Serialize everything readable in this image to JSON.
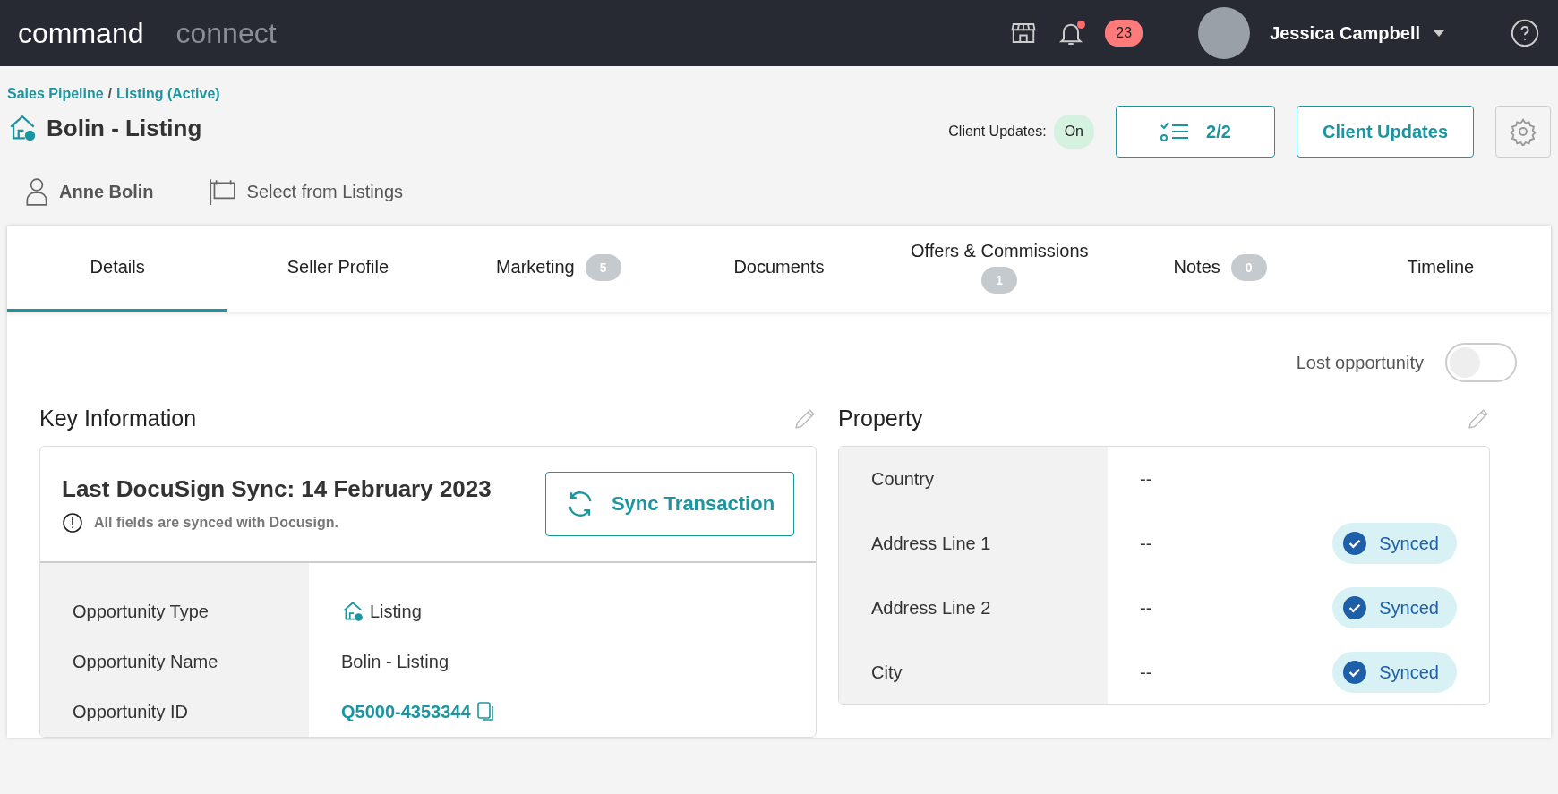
{
  "top_bar": {
    "brand_primary": "command",
    "brand_secondary": "connect",
    "notifications": {
      "unread": true,
      "count": "23"
    },
    "user": {
      "name": "Jessica Campbell"
    }
  },
  "header": {
    "breadcrumb": [
      {
        "label": "Sales Pipeline"
      },
      {
        "label": "Listing (Active)"
      }
    ],
    "breadcrumb_separator": "/",
    "title": "Bolin - Listing",
    "contact": "Anne Bolin",
    "listing_selector": "Select from Listings",
    "client_updates": {
      "label": "Client Updates:",
      "status": "On"
    },
    "tasks_button": "2/2",
    "client_updates_button": "Client Updates"
  },
  "tabs": [
    {
      "label": "Details",
      "selected": true
    },
    {
      "label": "Seller Profile",
      "selected": false
    },
    {
      "label": "Marketing",
      "count": "5",
      "selected": false
    },
    {
      "label": "Documents",
      "selected": false
    },
    {
      "label": "Offers & Commissions",
      "count": "1",
      "selected": false
    },
    {
      "label": "Notes",
      "count": "0",
      "selected": false
    },
    {
      "label": "Timeline",
      "selected": false
    }
  ],
  "lost_opportunity": {
    "label": "Lost opportunity",
    "on": false
  },
  "key_information": {
    "title": "Key Information",
    "sync_title": "Last DocuSign Sync: 14 February 2023",
    "sync_note": "All fields are synced with Docusign.",
    "sync_button": "Sync Transaction",
    "rows": [
      {
        "label": "Opportunity Type",
        "value": "Listing",
        "kind": "icon"
      },
      {
        "label": "Opportunity Name",
        "value": "Bolin - Listing",
        "kind": "text"
      },
      {
        "label": "Opportunity ID",
        "value": "Q5000-4353344",
        "kind": "link"
      }
    ]
  },
  "property": {
    "title": "Property",
    "rows": [
      {
        "label": "Country",
        "value": "--"
      },
      {
        "label": "Address Line 1",
        "value": "--",
        "badge": "Synced"
      },
      {
        "label": "Address Line 2",
        "value": "--",
        "badge": "Synced"
      },
      {
        "label": "City",
        "value": "--",
        "badge": "Synced"
      }
    ]
  }
}
